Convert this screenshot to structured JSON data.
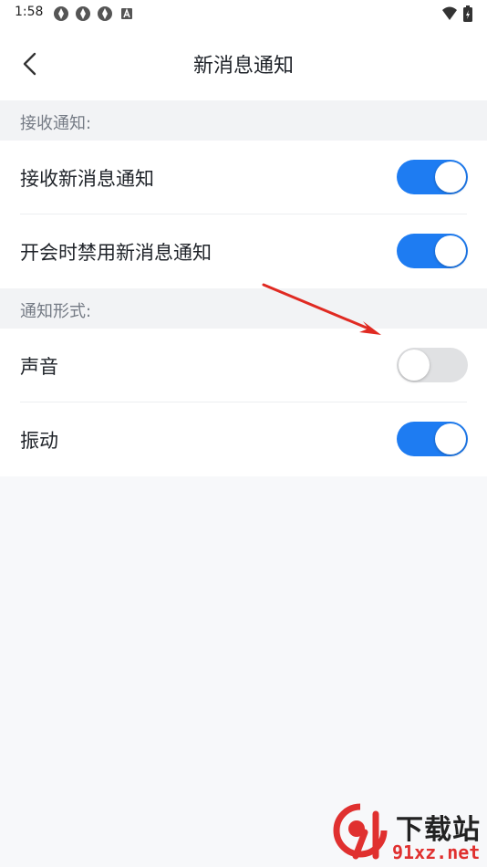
{
  "status_bar": {
    "time": "1:58",
    "icons": [
      "app-notification-icon",
      "app-notification-icon",
      "app-notification-icon",
      "a-icon",
      "wifi-icon",
      "battery-charging-icon"
    ]
  },
  "nav": {
    "title": "新消息通知",
    "back_icon": "chevron-left-icon"
  },
  "sections": [
    {
      "header": "接收通知:",
      "items": [
        {
          "label": "接收新消息通知",
          "enabled": true
        },
        {
          "label": "开会时禁用新消息通知",
          "enabled": true
        }
      ]
    },
    {
      "header": "通知形式:",
      "items": [
        {
          "label": "声音",
          "enabled": false
        },
        {
          "label": "振动",
          "enabled": true
        }
      ]
    }
  ],
  "colors": {
    "toggle_on": "#1e7cf2",
    "toggle_off": "#e0e1e3",
    "annotation_arrow": "#e02a22"
  },
  "watermark": {
    "text_top": "下载站",
    "text_bottom": "91xz.net"
  }
}
